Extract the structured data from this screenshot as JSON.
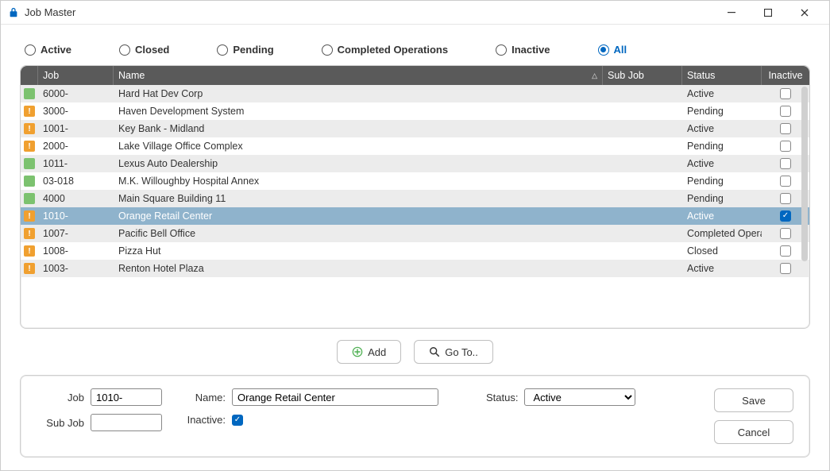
{
  "window": {
    "title": "Job Master"
  },
  "filters": {
    "options": [
      {
        "label": "Active",
        "checked": false
      },
      {
        "label": "Closed",
        "checked": false
      },
      {
        "label": "Pending",
        "checked": false
      },
      {
        "label": "Completed Operations",
        "checked": false
      },
      {
        "label": "Inactive",
        "checked": false
      },
      {
        "label": "All",
        "checked": true
      }
    ]
  },
  "grid": {
    "headers": {
      "job": "Job",
      "name": "Name",
      "subjob": "Sub Job",
      "status": "Status",
      "inactive": "Inactive"
    },
    "rows": [
      {
        "icon": "green",
        "job": "6000-",
        "name": "Hard Hat Dev Corp",
        "sub": "",
        "status": "Active",
        "inactive": false,
        "selected": false
      },
      {
        "icon": "orange",
        "job": "3000-",
        "name": "Haven Development System",
        "sub": "",
        "status": "Pending",
        "inactive": false,
        "selected": false
      },
      {
        "icon": "orange",
        "job": "1001-",
        "name": "Key Bank - Midland",
        "sub": "",
        "status": "Active",
        "inactive": false,
        "selected": false
      },
      {
        "icon": "orange",
        "job": "2000-",
        "name": "Lake Village Office Complex",
        "sub": "",
        "status": "Pending",
        "inactive": false,
        "selected": false
      },
      {
        "icon": "green",
        "job": "1011-",
        "name": "Lexus Auto Dealership",
        "sub": "",
        "status": "Active",
        "inactive": false,
        "selected": false
      },
      {
        "icon": "green",
        "job": "03-018",
        "name": "M.K. Willoughby Hospital Annex",
        "sub": "",
        "status": "Pending",
        "inactive": false,
        "selected": false
      },
      {
        "icon": "green",
        "job": "4000",
        "name": "Main Square Building 11",
        "sub": "",
        "status": "Pending",
        "inactive": false,
        "selected": false
      },
      {
        "icon": "orange",
        "job": "1010-",
        "name": "Orange Retail Center",
        "sub": "",
        "status": "Active",
        "inactive": true,
        "selected": true
      },
      {
        "icon": "orange",
        "job": "1007-",
        "name": "Pacific Bell Office",
        "sub": "",
        "status": "Completed Opera…",
        "inactive": false,
        "selected": false
      },
      {
        "icon": "orange",
        "job": "1008-",
        "name": "Pizza Hut",
        "sub": "",
        "status": "Closed",
        "inactive": false,
        "selected": false
      },
      {
        "icon": "orange",
        "job": "1003-",
        "name": "Renton Hotel Plaza",
        "sub": "",
        "status": "Active",
        "inactive": false,
        "selected": false
      }
    ]
  },
  "buttons": {
    "add": "Add",
    "goto": "Go To.."
  },
  "form": {
    "labels": {
      "job": "Job",
      "subjob": "Sub Job",
      "name": "Name:",
      "inactive": "Inactive:",
      "status": "Status:"
    },
    "values": {
      "job": "1010-",
      "subjob": "",
      "name": "Orange Retail Center",
      "status": "Active",
      "inactive": true
    },
    "actions": {
      "save": "Save",
      "cancel": "Cancel"
    }
  }
}
